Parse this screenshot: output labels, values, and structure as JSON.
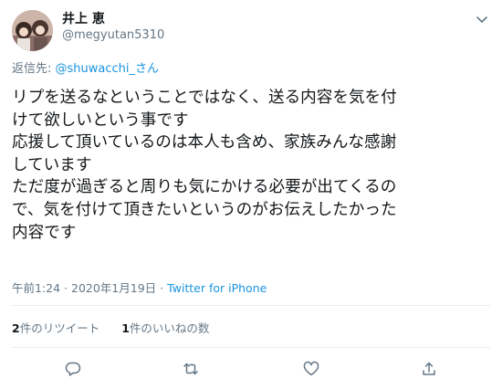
{
  "author": {
    "name": "井上 恵",
    "handle": "@megyutan5310"
  },
  "reply": {
    "prefix": "返信先: ",
    "mention": "@shuwacchi_さん"
  },
  "tweet_lines": [
    "リプを送るなということではなく、送る内容を気を付",
    "けて欲しいという事です",
    "応援して頂いているのは本人も含め、家族みんな感謝",
    "しています",
    "ただ度が過ぎると周りも気にかける必要が出てくるの",
    "で、気を付けて頂きたいというのがお伝えしたかった",
    "内容です"
  ],
  "meta": {
    "time": "午前1:24",
    "separator": " · ",
    "date": "2020年1月19日",
    "source": "Twitter for iPhone"
  },
  "stats": {
    "retweets_count": "2",
    "retweets_label": "件のリツイート",
    "likes_count": "1",
    "likes_label": "件のいいねの数"
  },
  "icons": {
    "caret": "chevron-down-icon",
    "reply": "reply-icon",
    "retweet": "retweet-icon",
    "like": "heart-icon",
    "share": "share-icon"
  },
  "colors": {
    "text": "#14171a",
    "muted": "#657786",
    "link": "#1b95e0",
    "divider": "#e6ecf0"
  }
}
